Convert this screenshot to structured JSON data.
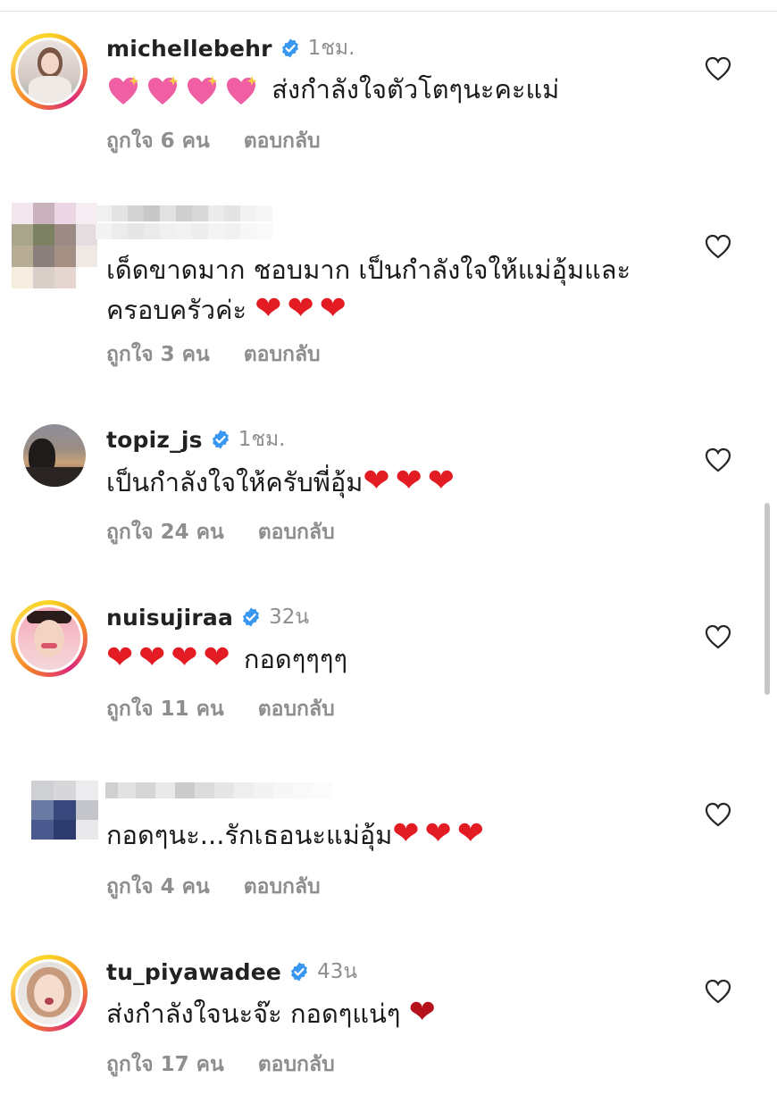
{
  "comments": [
    {
      "username": "michellebehr",
      "verified": true,
      "time": "1ชม.",
      "text_prefix_emoji": [
        "💖",
        "💖",
        "💖",
        "💖"
      ],
      "text": "ส่งกำลังใจตัวโตๆนะคะแม่",
      "likes": "ถูกใจ 6 คน",
      "reply": "ตอบกลับ"
    },
    {
      "username": "",
      "verified": false,
      "time": "",
      "text_line1": "เด็ดขาดมาก ชอบมาก เป็นกำลังใจให้แม่อุ้มและ",
      "text_line2": "ครอบครัวค่ะ",
      "hearts": [
        "❤",
        "❤",
        "❤"
      ],
      "likes": "ถูกใจ 3 คน",
      "reply": "ตอบกลับ"
    },
    {
      "username": "topiz_js",
      "verified": true,
      "time": "1ชม.",
      "text": "เป็นกำลังใจให้ครับพี่อุ้ม",
      "hearts": [
        "❤",
        "❤",
        "❤"
      ],
      "likes": "ถูกใจ 24 คน",
      "reply": "ตอบกลับ"
    },
    {
      "username": "nuisujiraa",
      "verified": true,
      "time": "32น",
      "hearts": [
        "❤",
        "❤",
        "❤",
        "❤"
      ],
      "text": "กอดๆๆๆๆ",
      "likes": "ถูกใจ 11 คน",
      "reply": "ตอบกลับ"
    },
    {
      "username": "",
      "verified": false,
      "time": "",
      "text": "กอดๆนะ...รักเธอนะแม่อุ้ม",
      "hearts": [
        "❤",
        "❤",
        "❤"
      ],
      "likes": "ถูกใจ 4 คน",
      "reply": "ตอบกลับ"
    },
    {
      "username": "tu_piyawadee",
      "verified": true,
      "time": "43น",
      "text": "ส่งกำลังใจนะจ๊ะ กอดๆแน่ๆ",
      "hearts": [
        "❤"
      ],
      "likes": "ถูกใจ 17 คน",
      "reply": "ตอบกลับ"
    }
  ],
  "colors": {
    "verified": "#3897f0",
    "heart": "#e31b23",
    "muted": "#8e8e8e"
  },
  "icons": {
    "like": "heart-outline-icon",
    "verified": "verified-badge-icon"
  }
}
